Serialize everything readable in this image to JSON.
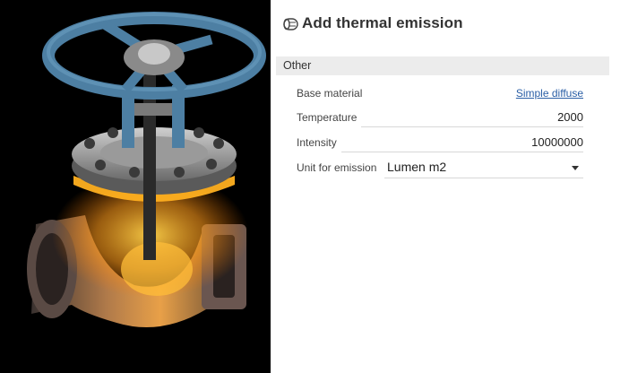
{
  "panel": {
    "title": "Add thermal emission",
    "header_icon": "thermal-emission-icon",
    "section": "Other",
    "fields": {
      "base_material": {
        "label": "Base material",
        "value": "Simple diffuse"
      },
      "temperature": {
        "label": "Temperature",
        "value": "2000"
      },
      "intensity": {
        "label": "Intensity",
        "value": "10000000"
      },
      "unit": {
        "label": "Unit for emission",
        "value": "Lumen m2"
      }
    }
  },
  "colors": {
    "link": "#2b5fa6",
    "section_bg": "#ececec",
    "emission_glow": "#ffb020",
    "handwheel": "#4d7fa3",
    "viewport_bg": "#000000"
  }
}
